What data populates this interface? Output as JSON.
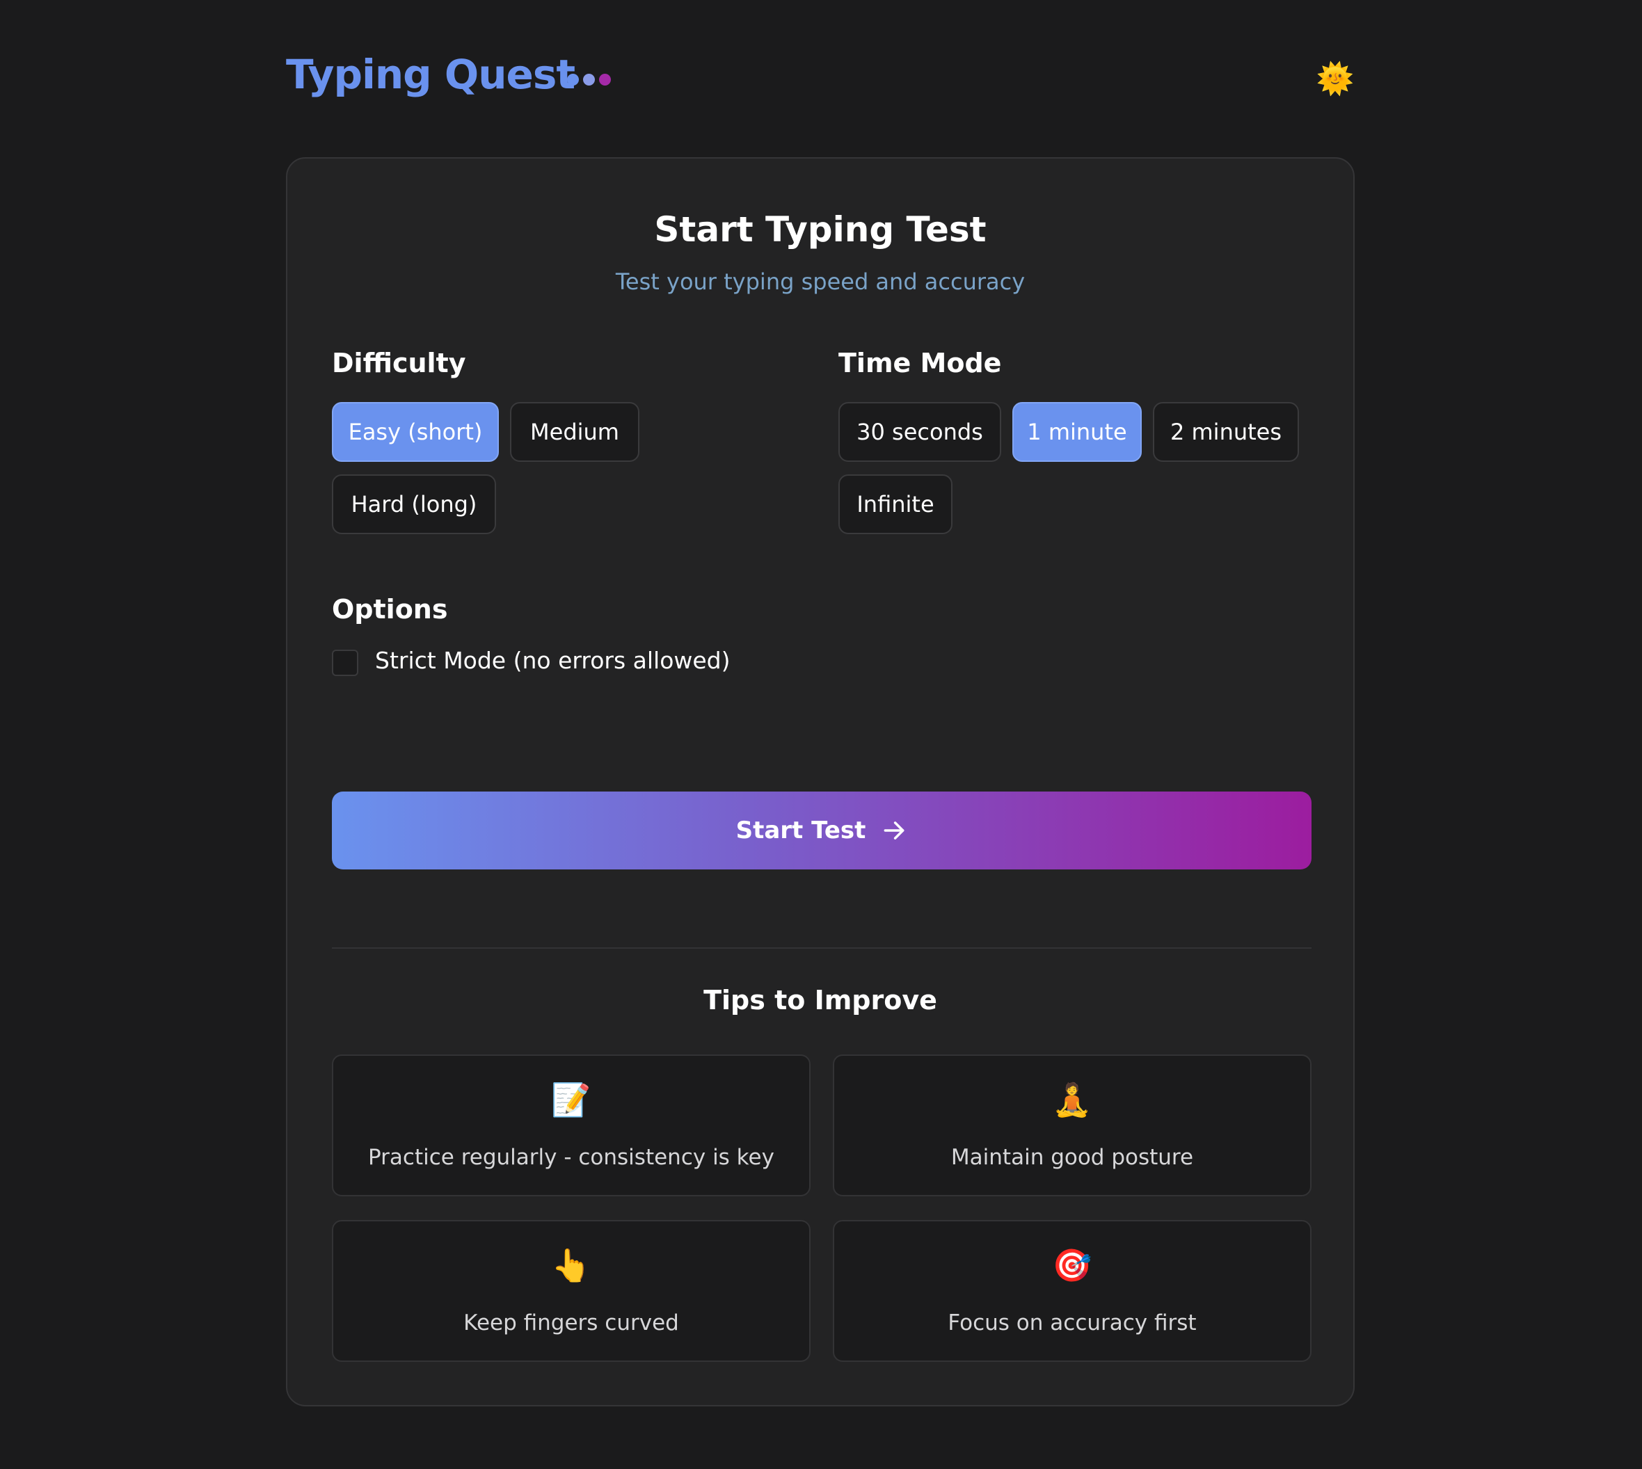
{
  "header": {
    "app_title": "Typing Quest",
    "dot_colors": [
      "#6a92ee",
      "#8a6ad8",
      "#a52aa8"
    ],
    "theme_toggle_glyph": "🌞",
    "theme_toggle_icon": "sun-icon"
  },
  "card": {
    "title": "Start Typing Test",
    "subtitle": "Test your typing speed and accuracy"
  },
  "difficulty": {
    "label": "Difficulty",
    "options": [
      "Easy (short)",
      "Medium",
      "Hard (long)"
    ],
    "selected": "Easy (short)"
  },
  "time_mode": {
    "label": "Time Mode",
    "options": [
      "30 seconds",
      "1 minute",
      "2 minutes",
      "Infinite"
    ],
    "selected": "1 minute"
  },
  "options": {
    "label": "Options",
    "strict_mode_label": "Strict Mode (no errors allowed)",
    "strict_mode_checked": false
  },
  "start_button": {
    "label": "Start Test",
    "icon": "arrow-right-icon"
  },
  "tips": {
    "title": "Tips to Improve",
    "items": [
      {
        "icon": "📝",
        "icon_name": "memo-icon",
        "text": "Practice regularly - consistency is key"
      },
      {
        "icon": "🧘",
        "icon_name": "meditation-icon",
        "text": "Maintain good posture"
      },
      {
        "icon": "👆",
        "icon_name": "pointing-finger-icon",
        "text": "Keep fingers curved"
      },
      {
        "icon": "🎯",
        "icon_name": "target-icon",
        "text": "Focus on accuracy first"
      }
    ]
  },
  "colors": {
    "background": "#1b1b1c",
    "card": "#232324",
    "accent": "#6a92ee",
    "gradient_end": "#9c1d9f",
    "subtitle": "#7aa3c8"
  }
}
